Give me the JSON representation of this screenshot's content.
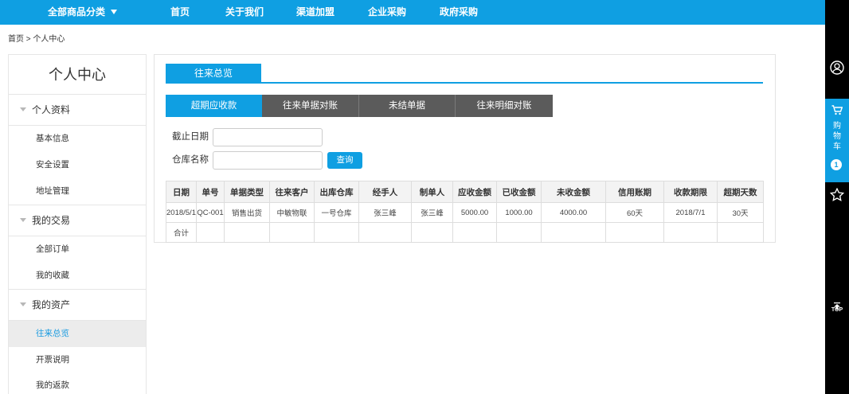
{
  "colors": {
    "primary": "#0f9fe2",
    "subtab_inactive": "#5b5b5b",
    "right_bar": "#000000",
    "active_text": "#1a9be0"
  },
  "nav": {
    "category_label": "全部商品分类",
    "items": [
      {
        "label": "首页"
      },
      {
        "label": "关于我们"
      },
      {
        "label": "渠道加盟"
      },
      {
        "label": "企业采购"
      },
      {
        "label": "政府采购"
      }
    ]
  },
  "breadcrumb": {
    "home": "首页",
    "separator": ">",
    "current": "个人中心"
  },
  "sidebar": {
    "title": "个人中心",
    "sections": [
      {
        "label": "个人资料",
        "items": [
          {
            "label": "基本信息"
          },
          {
            "label": "安全设置"
          },
          {
            "label": "地址管理"
          }
        ]
      },
      {
        "label": "我的交易",
        "items": [
          {
            "label": "全部订单"
          },
          {
            "label": "我的收藏"
          }
        ]
      },
      {
        "label": "我的资产",
        "items": [
          {
            "label": "往来总览",
            "active": true
          },
          {
            "label": "开票说明"
          },
          {
            "label": "我的返款"
          }
        ]
      }
    ]
  },
  "main": {
    "tab_label": "往来总览",
    "subtabs": [
      {
        "label": "超期应收款",
        "active": true
      },
      {
        "label": "往来单据对账"
      },
      {
        "label": "未结单据"
      },
      {
        "label": "往来明细对账"
      }
    ],
    "filters": {
      "date_label": "截止日期",
      "warehouse_label": "仓库名称",
      "query_button": "查询"
    },
    "table": {
      "headers": [
        "日期",
        "单号",
        "单据类型",
        "往来客户",
        "出库仓库",
        "经手人",
        "制单人",
        "应收金额",
        "已收金额",
        "未收金额",
        "信用账期",
        "收款期限",
        "超期天数"
      ],
      "rows": [
        [
          "2018/5/1",
          "QC-001",
          "销售出货",
          "中敏物联",
          "一号仓库",
          "张三峰",
          "张三峰",
          "5000.00",
          "1000.00",
          "4000.00",
          "60天",
          "2018/7/1",
          "30天"
        ]
      ],
      "total_label": "合计"
    }
  },
  "right_bar": {
    "cart_label": "购物车",
    "cart_count": "1",
    "top_label": "TOP",
    "icons": [
      "user-icon",
      "cart-icon",
      "star-icon",
      "arrow-up-icon"
    ]
  }
}
